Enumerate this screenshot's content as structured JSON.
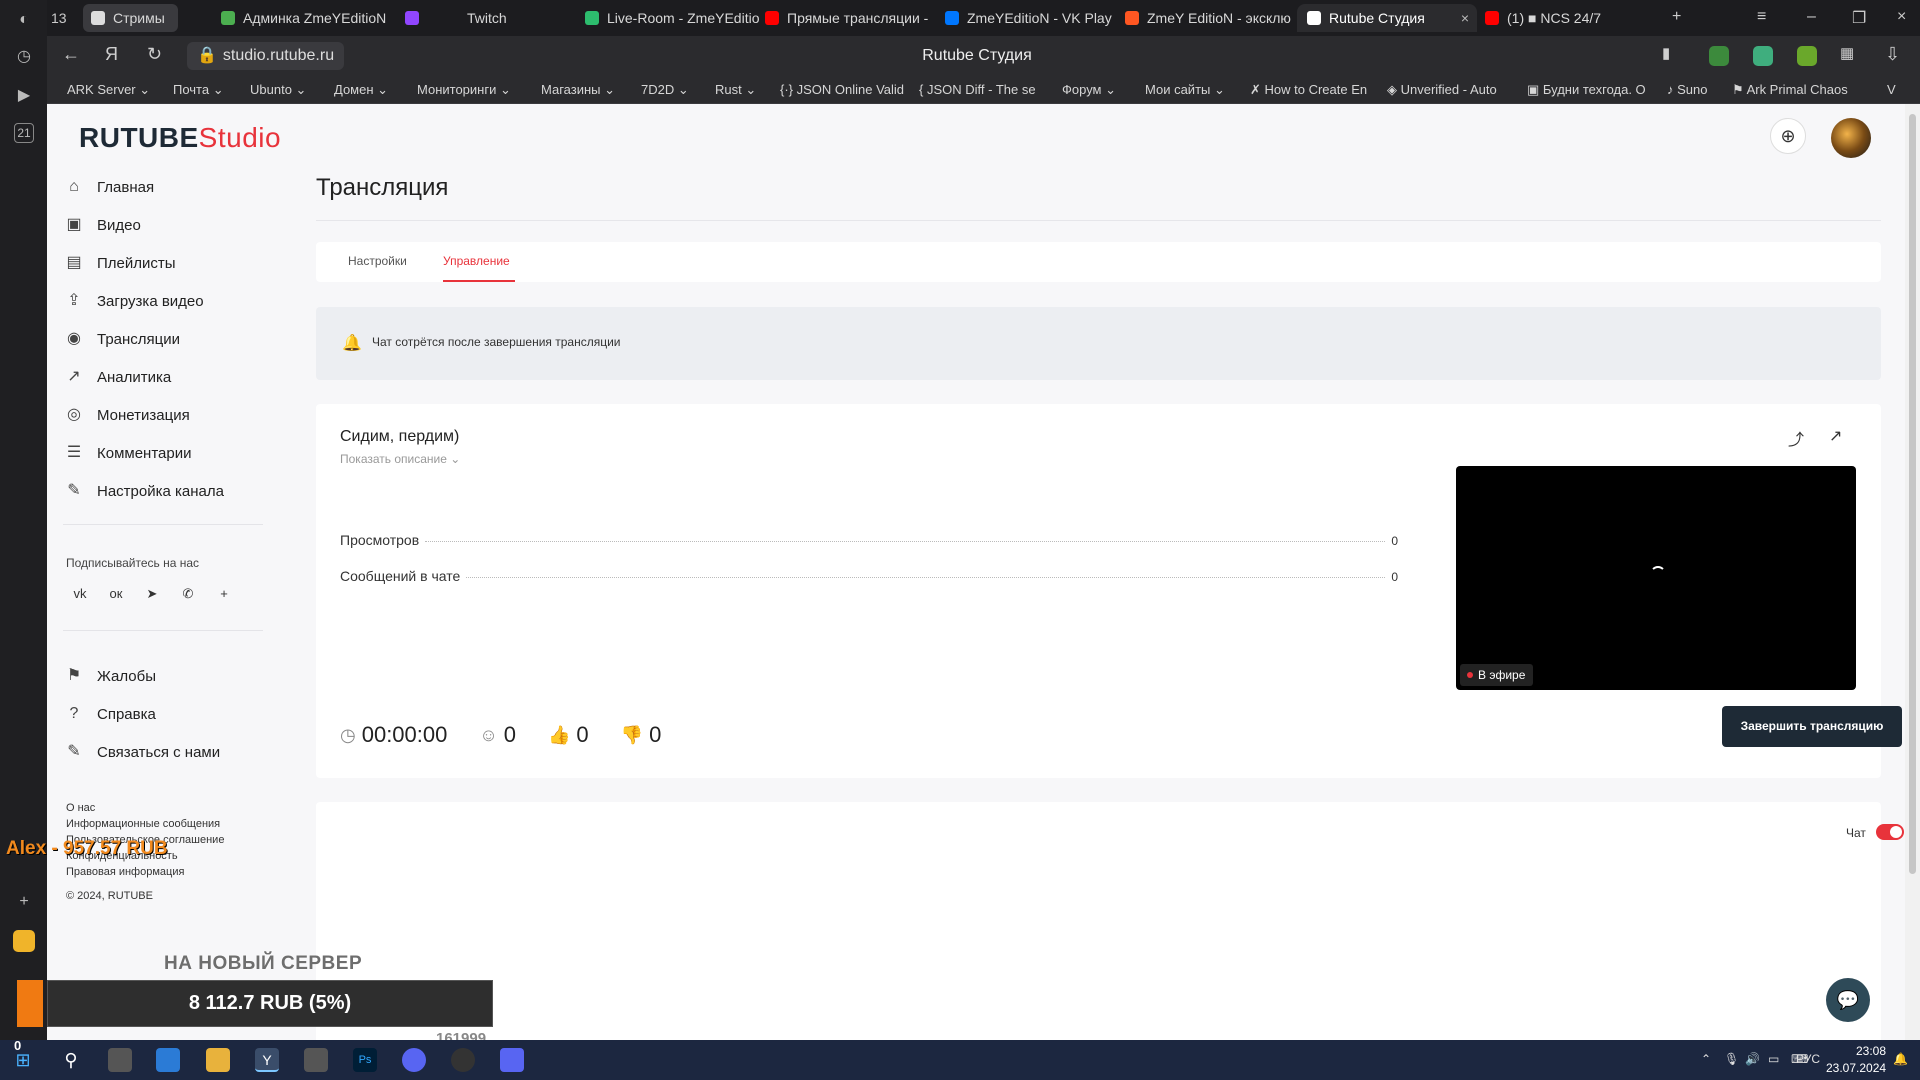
{
  "browser": {
    "sidebar": {
      "badge": "21"
    },
    "tab_counter": "13",
    "tabs": [
      {
        "label": "Стримы",
        "color": "#ffffff"
      },
      {
        "label": "Админка ZmeYEditioN",
        "color": "#4caf50"
      },
      {
        "label": "Twitch",
        "color": "#9146ff"
      },
      {
        "label": "Live-Room - ZmeYEditio",
        "color": "#2dbd6e"
      },
      {
        "label": "Прямые трансляции -",
        "color": "#ff0000"
      },
      {
        "label": "ZmeYEditioN - VK Play",
        "color": "#0077ff"
      },
      {
        "label": "ZmeY EditioN - эксклю",
        "color": "#ff5722"
      },
      {
        "label": "Rutube Студия",
        "color": "#ffffff"
      },
      {
        "label": "(1) ■ NCS 24/7",
        "color": "#ff0000"
      }
    ],
    "url": "studio.rutube.ru",
    "page_title": "Rutube Студия",
    "bookmarks": [
      "ARK Server",
      "Почта",
      "Ubunto",
      "Домен",
      "Мониторинги",
      "Магазины",
      "7D2D",
      "Rust",
      "JSON Online Valid",
      "JSON Diff - The se",
      "Форум",
      "Мои сайты",
      "How to Create En",
      "Unverified - Auto",
      "Будни техгода. О",
      "Suno",
      "Ark Primal Chaos",
      "V"
    ]
  },
  "rutube": {
    "logo_main": "RUTUBE",
    "logo_sub": "Studio",
    "menu": [
      {
        "label": "Главная",
        "icon": "home-icon",
        "glyph": "⌂"
      },
      {
        "label": "Видео",
        "icon": "video-icon",
        "glyph": "▣"
      },
      {
        "label": "Плейлисты",
        "icon": "playlist-icon",
        "glyph": "▤"
      },
      {
        "label": "Загрузка видео",
        "icon": "upload-icon",
        "glyph": "⇪"
      },
      {
        "label": "Трансляции",
        "icon": "broadcast-icon",
        "glyph": "◉"
      },
      {
        "label": "Аналитика",
        "icon": "analytics-icon",
        "glyph": "↗"
      },
      {
        "label": "Монетизация",
        "icon": "monetization-icon",
        "glyph": "◎"
      },
      {
        "label": "Комментарии",
        "icon": "comments-icon",
        "glyph": "☰"
      },
      {
        "label": "Настройка канала",
        "icon": "wand-icon",
        "glyph": "✎"
      }
    ],
    "subscribe_label": "Подписывайтесь на нас",
    "social": [
      {
        "name": "vk-icon",
        "glyph": "vk"
      },
      {
        "name": "ok-icon",
        "glyph": "ок"
      },
      {
        "name": "telegram-icon",
        "glyph": "➤"
      },
      {
        "name": "viber-icon",
        "glyph": "✆"
      },
      {
        "name": "more-icon",
        "glyph": "+"
      }
    ],
    "menu2": [
      {
        "label": "Жалобы",
        "icon": "flag-icon",
        "glyph": "⚑"
      },
      {
        "label": "Справка",
        "icon": "help-icon",
        "glyph": "?"
      },
      {
        "label": "Связаться с нами",
        "icon": "contact-icon",
        "glyph": "✎"
      }
    ],
    "footer_links": [
      "О нас",
      "Информационные сообщения",
      "Пользовательское соглашение",
      "Конфиденциальность",
      "Правовая информация"
    ],
    "copyright": "© 2024, RUTUBE",
    "page_title": "Трансляция",
    "tabs": [
      "Настройки",
      "Управление"
    ],
    "active_tab": "Управление",
    "notice": "Чат сотрётся после завершения трансляции",
    "stream": {
      "title": "Сидим, пердим)",
      "show_description": "Показать описание ⌄",
      "stats": [
        {
          "label": "Просмотров",
          "value": "0"
        },
        {
          "label": "Сообщений в чате",
          "value": "0"
        }
      ],
      "timer": "00:00:00",
      "viewers": "0",
      "likes": "0",
      "dislikes": "0",
      "live_label": "В эфире",
      "end_button": "Завершить трансляцию"
    },
    "chat_label": "Чат",
    "chat_enabled": true
  },
  "overlay": {
    "donor": "Alex - 957.57 RUB",
    "goal_title": "НА НОВЫЙ СЕРВЕР",
    "goal_value": "8 112.7 RUB (5%)",
    "goal_total": "161999",
    "goal_progress_percent": 5
  },
  "taskbar": {
    "lang": "РУС",
    "time": "23:08",
    "date": "23.07.2024",
    "sidebar_count": "0"
  }
}
